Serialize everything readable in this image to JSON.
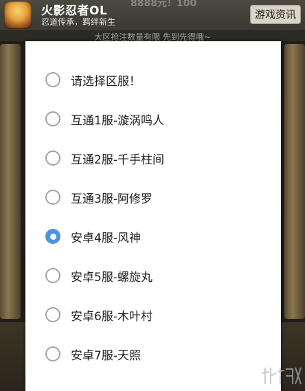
{
  "header": {
    "app_title": "火影忍者OL",
    "app_subtitle": "忍道传承，羁绊新生",
    "faded_overlay_text": "8888元！100",
    "news_button_label": "游戏资讯"
  },
  "notice": {
    "text": "大区抢注数量有限 先到先得哦~"
  },
  "server_options": [
    {
      "label": "请选择区服！",
      "checked": false
    },
    {
      "label": "互通1服-漩涡鸣人",
      "checked": false
    },
    {
      "label": "互通2服-千手柱间",
      "checked": false
    },
    {
      "label": "互通3服-阿修罗",
      "checked": false
    },
    {
      "label": "安卓4服-风神",
      "checked": true
    },
    {
      "label": "安卓5服-螺旋丸",
      "checked": false
    },
    {
      "label": "安卓6服-木叶村",
      "checked": false
    },
    {
      "label": "安卓7服-天照",
      "checked": false
    }
  ],
  "colors": {
    "radio_selected": "#4f94e2",
    "radio_unselected_border": "#a3a3a3",
    "dialog_background": "#ffffff"
  }
}
